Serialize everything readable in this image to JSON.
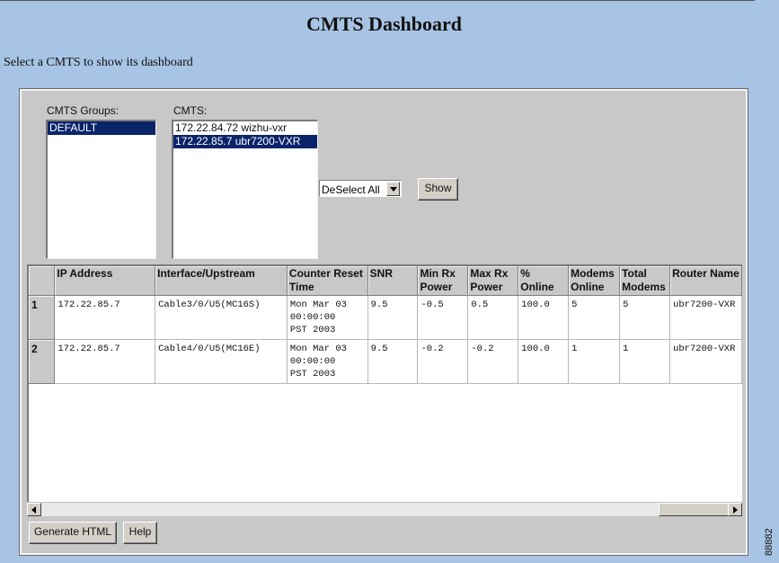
{
  "page": {
    "title": "CMTS Dashboard",
    "subtitle": "Select a CMTS to show its dashboard",
    "figure_id": "88882"
  },
  "groups": {
    "label": "CMTS Groups:",
    "items": [
      {
        "label": "DEFAULT",
        "selected": true
      }
    ]
  },
  "cmts": {
    "label": "CMTS:",
    "items": [
      {
        "label": "172.22.84.72 wizhu-vxr",
        "selected": false
      },
      {
        "label": "172.22.85.7 ubr7200-VXR",
        "selected": true
      }
    ]
  },
  "controls": {
    "select_value": "DeSelect All",
    "show_label": "Show"
  },
  "table": {
    "headers": [
      "",
      "IP Address",
      "Interface/Upstream",
      "Counter Reset Time",
      "SNR",
      "Min Rx Power",
      "Max Rx Power",
      "% Online",
      "Modems Online",
      "Total Modems",
      "Router Name"
    ],
    "rows": [
      [
        "1",
        "172.22.85.7",
        "Cable3/0/U5(MC16S)",
        "Mon Mar 03\n00:00:00\nPST 2003",
        "9.5",
        "-0.5",
        "0.5",
        "100.0",
        "5",
        "5",
        "ubr7200-VXR"
      ],
      [
        "2",
        "172.22.85.7",
        "Cable4/0/U5(MC16E)",
        "Mon Mar 03\n00:00:00\nPST 2003",
        "9.5",
        "-0.2",
        "-0.2",
        "100.0",
        "1",
        "1",
        "ubr7200-VXR"
      ]
    ]
  },
  "footer": {
    "generate_label": "Generate HTML",
    "help_label": "Help"
  },
  "colors": {
    "page_background": "#a8c4e4",
    "panel": "#c8c8c8",
    "selection": "#0a246a"
  }
}
